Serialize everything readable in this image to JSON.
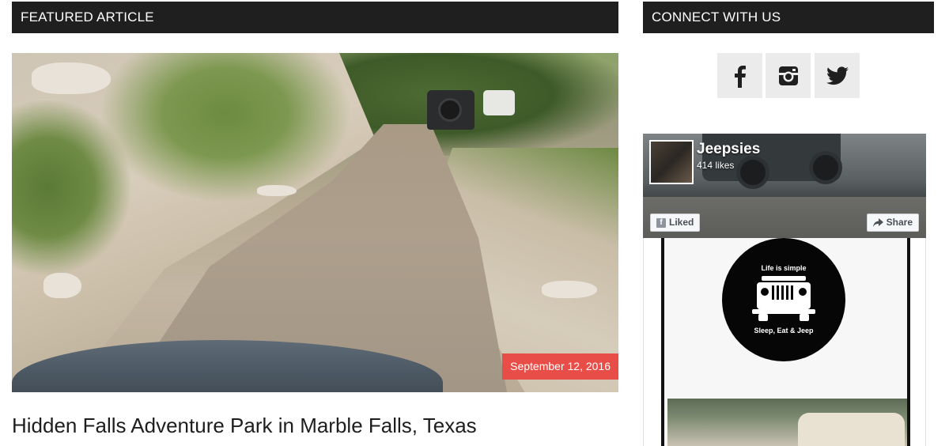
{
  "featured": {
    "heading": "FEATURED ARTICLE",
    "date": "September 12, 2016",
    "title": "Hidden Falls Adventure Park in Marble Falls, Texas",
    "image_description": "muddy creek trail with jeeps"
  },
  "connect": {
    "heading": "CONNECT WITH US",
    "social": [
      {
        "icon": "facebook-icon"
      },
      {
        "icon": "instagram-icon"
      },
      {
        "icon": "twitter-icon"
      }
    ]
  },
  "facebook_widget": {
    "page_name": "Jeepsies",
    "likes": "414 likes",
    "liked_label": "Liked",
    "share_label": "Share",
    "post": {
      "logo_top_text": "Life is simple",
      "logo_bottom_text": "Sleep, Eat & Jeep"
    }
  },
  "colors": {
    "header_bar": "#1f1f1f",
    "date_badge": "#e84e47",
    "social_button_bg": "#ebebeb"
  }
}
